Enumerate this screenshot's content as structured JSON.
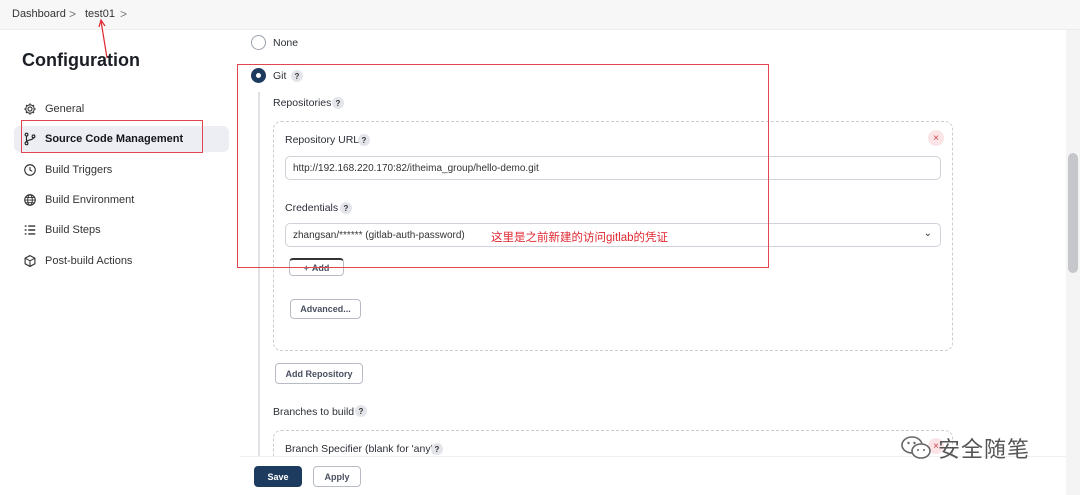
{
  "breadcrumb": {
    "items": [
      "Dashboard",
      "test01"
    ],
    "separator": ">"
  },
  "sidebar": {
    "title": "Configuration",
    "items": [
      {
        "label": "General",
        "icon": "gear-icon",
        "active": false
      },
      {
        "label": "Source Code Management",
        "icon": "branch-icon",
        "active": true
      },
      {
        "label": "Build Triggers",
        "icon": "clock-icon",
        "active": false
      },
      {
        "label": "Build Environment",
        "icon": "globe-icon",
        "active": false
      },
      {
        "label": "Build Steps",
        "icon": "list-icon",
        "active": false
      },
      {
        "label": "Post-build Actions",
        "icon": "package-icon",
        "active": false
      }
    ]
  },
  "scm": {
    "options": [
      {
        "label": "None",
        "selected": false
      },
      {
        "label": "Git",
        "selected": true
      }
    ],
    "help_glyph": "?",
    "repositories_label": "Repositories",
    "repo_url_label": "Repository URL",
    "repo_url_value": "http://192.168.220.170:82/itheima_group/hello-demo.git",
    "credentials_label": "Credentials",
    "credentials_value": "zhangsan/****** (gitlab-auth-password)",
    "add_button": "Add",
    "add_glyph": "+",
    "advanced_button": "Advanced...",
    "add_repository_button": "Add Repository",
    "branches_label": "Branches to build",
    "branch_specifier_label": "Branch Specifier (blank for 'any')",
    "remove_glyph": "×",
    "chevron": "⌄"
  },
  "annotation": {
    "text": "这里是之前新建的访问gitlab的凭证",
    "color": "#e0262f"
  },
  "actions": {
    "save": "Save",
    "apply": "Apply"
  },
  "watermark": {
    "text": "安全随笔"
  },
  "colors": {
    "primary": "#1d3a5f",
    "annotation_red": "#e0464f"
  }
}
